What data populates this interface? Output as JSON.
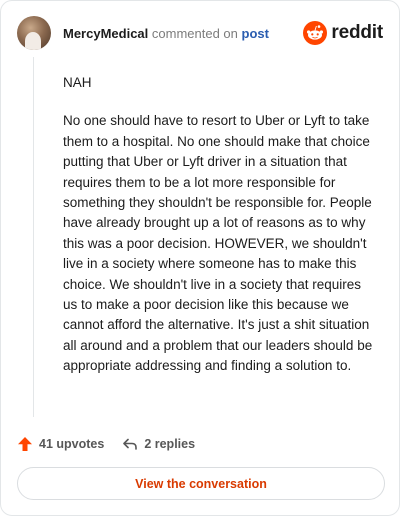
{
  "header": {
    "username": "MercyMedical",
    "action_text": "commented on",
    "post_link": "post",
    "brand_name": "reddit",
    "brand_icon": "reddit-alien-icon",
    "brand_color": "#ff4500"
  },
  "comment": {
    "paragraphs": [
      "NAH",
      "No one should have to resort to Uber or Lyft to take them to a hospital. No one should make that choice putting that Uber or Lyft driver in a situation that requires them to be a lot more responsible for something they shouldn't be responsible for. People have already brought up a lot of reasons as to why this was a poor decision. HOWEVER, we shouldn't live in a society where someone has to make this choice. We shouldn't live in a society that requires us to make a poor decision like this because we cannot afford the alternative. It's just a shit situation all around and a problem that our leaders should be appropriate addressing and finding a solution to."
    ]
  },
  "actions": {
    "upvotes_label": "41 upvotes",
    "upvote_icon": "upvote-arrow-icon",
    "upvote_color": "#ff4500",
    "replies_label": "2 replies",
    "reply_icon": "reply-arrow-icon"
  },
  "footer": {
    "view_button_label": "View the conversation",
    "accent_color": "#d93a00"
  }
}
